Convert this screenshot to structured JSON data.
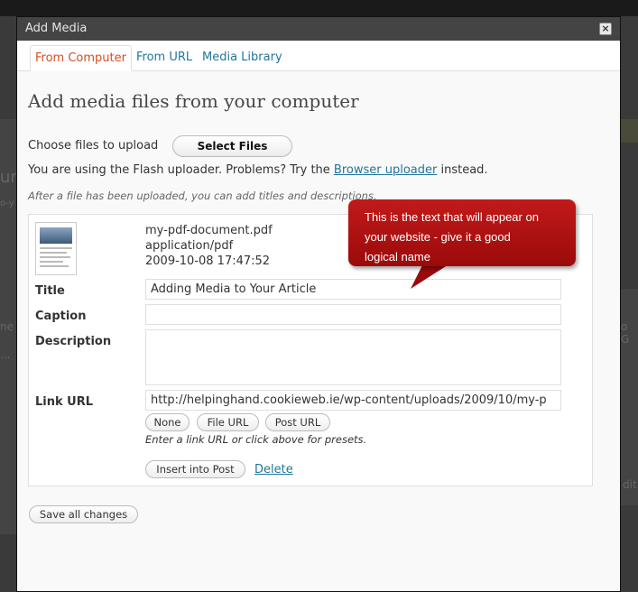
{
  "modal": {
    "title": "Add Media",
    "close_label": "×"
  },
  "tabs": [
    {
      "label": "From Computer",
      "active": true
    },
    {
      "label": "From URL",
      "active": false
    },
    {
      "label": "Media Library",
      "active": false
    }
  ],
  "upload": {
    "heading": "Add media files from your computer",
    "choose_label": "Choose files to upload",
    "select_button": "Select Files",
    "flash_note_prefix": "You are using the Flash uploader. Problems? Try the ",
    "flash_note_link": "Browser uploader",
    "flash_note_suffix": " instead.",
    "after_note": "After a file has been uploaded, you can add titles and descriptions."
  },
  "file": {
    "filename": "my-pdf-document.pdf",
    "mime": "application/pdf",
    "date": "2009-10-08 17:47:52",
    "fields": {
      "title_label": "Title",
      "title_value": "Adding Media to Your Article",
      "caption_label": "Caption",
      "caption_value": "",
      "description_label": "Description",
      "description_value": "",
      "link_label": "Link URL",
      "link_value": "http://helpinghand.cookieweb.ie/wp-content/uploads/2009/10/my-p"
    },
    "link_buttons": {
      "none": "None",
      "file_url": "File URL",
      "post_url": "Post URL"
    },
    "link_help": "Enter a link URL or click above for presets.",
    "insert_button": "Insert into Post",
    "delete_link": "Delete"
  },
  "save_all": "Save all changes",
  "callout": {
    "line1": "This is the text that will appear on",
    "line2": "your website - give it a good",
    "line3": "logical name"
  },
  "background": {
    "frag_ur": "ur",
    "frag_o": "o-y",
    "frag_ne": "ne",
    "frag_dots": "...",
    "frag_g": "o G",
    "frag_dit": "dit"
  },
  "colors": {
    "accent_link": "#21759b",
    "active_tab": "#d54e21",
    "callout": "#b01212"
  }
}
